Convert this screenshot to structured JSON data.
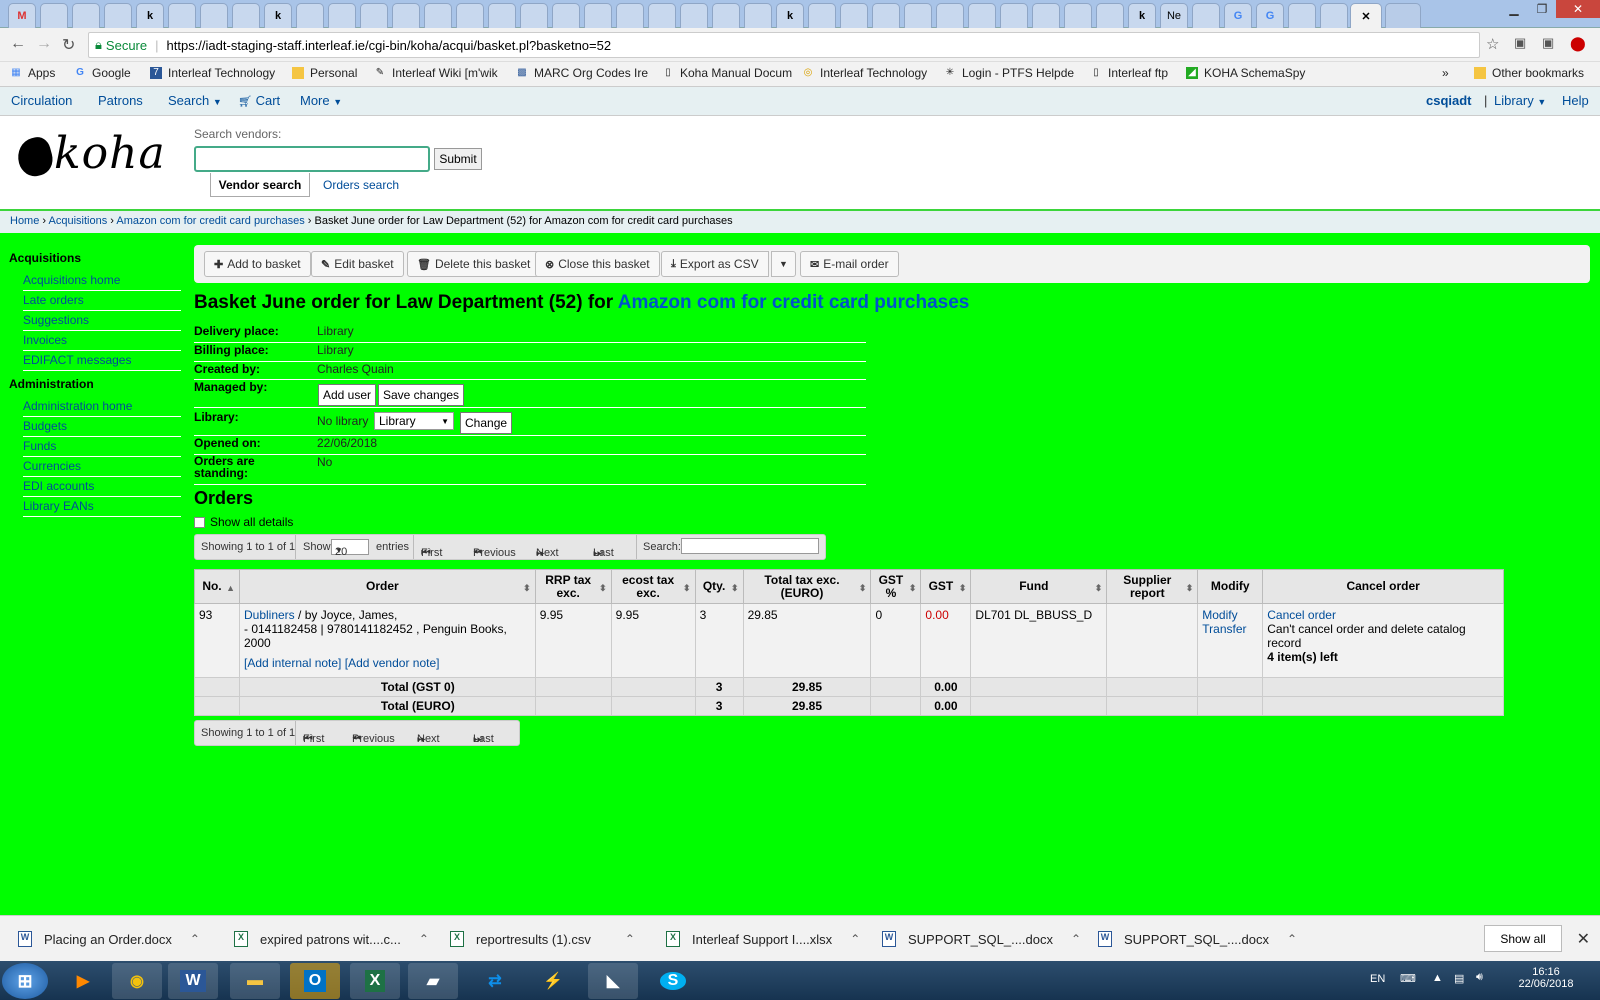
{
  "browser": {
    "tabs_visible": [
      "M",
      "k",
      "k",
      "k",
      "k",
      "Ne",
      "G",
      "G"
    ],
    "url": "https://iadt-staging-staff.interleaf.ie/cgi-bin/koha/acqui/basket.pl?basketno=52",
    "secure_label": "Secure",
    "bookmarks": [
      "Apps",
      "Google",
      "Interleaf Technology",
      "Personal",
      "Interleaf Wiki [m'wik",
      "MARC Org Codes Ire",
      "Koha Manual Docum",
      "Interleaf Technology",
      "Login - PTFS Helpde",
      "Interleaf ftp",
      "KOHA SchemaSpy"
    ],
    "bookmarks_more": "»",
    "other_bookmarks": "Other bookmarks"
  },
  "koha_nav": {
    "circulation": "Circulation",
    "patrons": "Patrons",
    "search": "Search",
    "cart": "Cart",
    "more": "More",
    "user": "csqiadt",
    "library": "Library",
    "help": "Help"
  },
  "header": {
    "logo": "koha",
    "search_label": "Search vendors:",
    "search_value": "",
    "submit": "Submit",
    "tab_vendor": "Vendor search",
    "tab_orders": "Orders search"
  },
  "breadcrumb": {
    "home": "Home",
    "acquisitions": "Acquisitions",
    "vendor": "Amazon com for credit card purchases",
    "current": "Basket June order for Law Department (52) for Amazon com for credit card purchases"
  },
  "sidebar": {
    "acq_heading": "Acquisitions",
    "acq_items": [
      "Acquisitions home",
      "Late orders",
      "Suggestions",
      "Invoices",
      "EDIFACT messages"
    ],
    "admin_heading": "Administration",
    "admin_items": [
      "Administration home",
      "Budgets",
      "Funds",
      "Currencies",
      "EDI accounts",
      "Library EANs"
    ]
  },
  "toolbar": {
    "add": "Add to basket",
    "edit": "Edit basket",
    "delete": "Delete this basket",
    "close": "Close this basket",
    "export": "Export as CSV",
    "email": "E-mail order"
  },
  "basket": {
    "title_prefix": "Basket June order for Law Department (52) for",
    "vendor_link": "Amazon com for credit card purchases",
    "delivery_label": "Delivery place:",
    "delivery": "Library",
    "billing_label": "Billing place:",
    "billing": "Library",
    "created_label": "Created by:",
    "created": "Charles Quain",
    "managed_label": "Managed by:",
    "add_user": "Add user",
    "save_changes": "Save changes",
    "library_label": "Library:",
    "library_value": "No library",
    "library_select": "Library",
    "change": "Change",
    "opened_label": "Opened on:",
    "opened": "22/06/2018",
    "standing_label": "Orders are standing:",
    "standing": "No"
  },
  "orders": {
    "heading": "Orders",
    "show_all": "Show all details",
    "showing": "Showing 1 to 1 of 1",
    "show": "Show",
    "entries_value": "20",
    "entries": "entries",
    "first": "First",
    "previous": "Previous",
    "next": "Next",
    "last": "Last",
    "search": "Search:",
    "columns": [
      "No.",
      "Order",
      "RRP tax exc.",
      "ecost tax exc.",
      "Qty.",
      "Total tax exc. (EURO)",
      "GST %",
      "GST",
      "Fund",
      "Supplier report",
      "Modify",
      "Cancel order"
    ],
    "row": {
      "no": "93",
      "title": "Dubliners",
      "author": " / by Joyce, James,",
      "details": "- 0141182458 | 9780141182452 , Penguin Books, 2000",
      "internal_note": "[Add internal note]",
      "vendor_note": "[Add vendor note]",
      "rrp": "9.95",
      "ecost": "9.95",
      "qty": "3",
      "total": "29.85",
      "gst_pct": "0",
      "gst": "0.00",
      "fund": "DL701 DL_BBUSS_D",
      "modify": "Modify",
      "transfer": "Transfer",
      "cancel": "Cancel order",
      "cancel_note": "Can't cancel order and delete catalog record",
      "items_left": "4 item(s) left"
    },
    "totals": [
      {
        "label": "Total (GST 0)",
        "qty": "3",
        "total": "29.85",
        "gst": "0.00"
      },
      {
        "label": "Total (EURO)",
        "qty": "3",
        "total": "29.85",
        "gst": "0.00"
      }
    ]
  },
  "downloads": [
    "Placing an Order.docx",
    "expired patrons wit....c...",
    "reportresults (1).csv",
    "Interleaf Support I....xlsx",
    "SUPPORT_SQL_....docx",
    "SUPPORT_SQL_....docx"
  ],
  "downloads_show_all": "Show all",
  "taskbar": {
    "lang": "EN",
    "time": "16:16",
    "date": "22/06/2018"
  }
}
